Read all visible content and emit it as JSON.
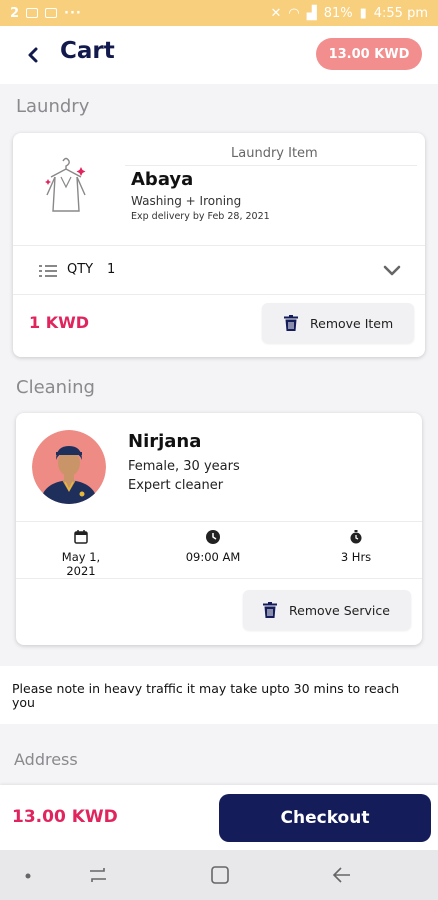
{
  "status_bar": {
    "notif_count": "2",
    "dots": "···",
    "battery": "81%",
    "time": "4:55 pm"
  },
  "header": {
    "title": "Cart",
    "total": "13.00 KWD"
  },
  "laundry": {
    "section_title": "Laundry",
    "item_type": "Laundry Item",
    "item_name": "Abaya",
    "service": "Washing + Ironing",
    "delivery": "Exp delivery by Feb 28, 2021",
    "qty_label": "QTY",
    "qty_value": "1",
    "price": "1 KWD",
    "remove_label": "Remove Item"
  },
  "cleaning": {
    "section_title": "Cleaning",
    "name": "Nirjana",
    "info": "Female, 30 years",
    "role": "Expert cleaner",
    "date": "May 1, 2021",
    "time": "09:00 AM",
    "duration": "3 Hrs",
    "remove_label": "Remove Service"
  },
  "note": "Please note in heavy traffic it may take upto 30 mins to reach you",
  "address_title": "Address",
  "footer": {
    "total": "13.00 KWD",
    "checkout_label": "Checkout"
  },
  "colors": {
    "brand": "#141c5a",
    "accent": "#e0245e",
    "pill": "#f28e8e",
    "status": "#f8cf7c"
  }
}
